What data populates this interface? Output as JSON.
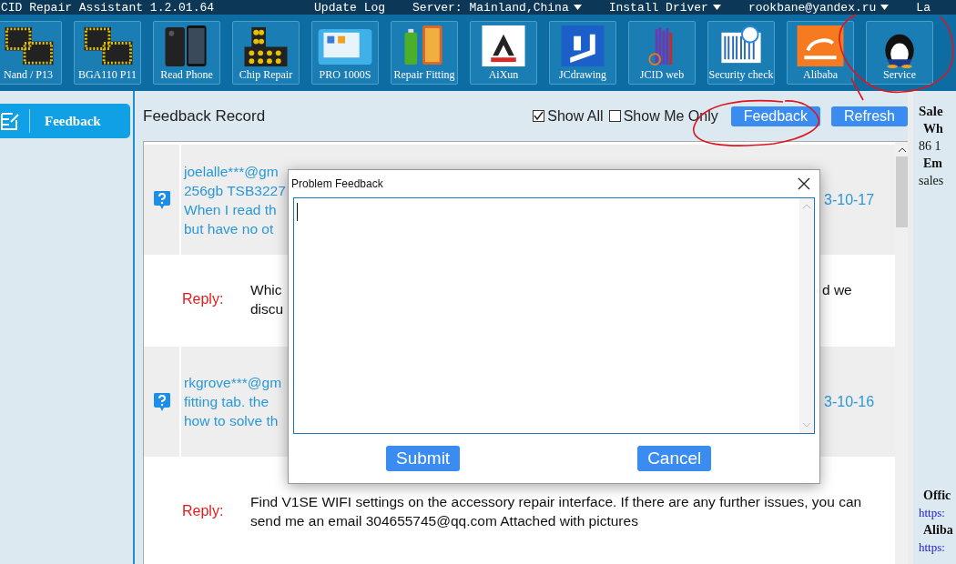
{
  "top_bar": {
    "app_title": "CID Repair Assistant 1.2.01.64",
    "menus": [
      {
        "label": "Update Log",
        "dropdown": false
      },
      {
        "label": "Server: Mainland,China",
        "dropdown": true
      },
      {
        "label": "Install Driver",
        "dropdown": true
      },
      {
        "label": "rookbane@yandex.ru",
        "dropdown": true
      },
      {
        "label": "La",
        "dropdown": false
      }
    ]
  },
  "toolbar": {
    "tools": [
      "Nand / P13",
      "BGA110 P11",
      "Read Phone",
      "Chip Repair",
      "PRO 1000S",
      "Repair Fitting",
      "AiXun",
      "JCdrawing",
      "JCID web",
      "Security check",
      "Alibaba",
      "Service"
    ]
  },
  "sidebar": {
    "items": [
      {
        "label": "Feedback",
        "selected": true
      }
    ]
  },
  "content": {
    "title": "Feedback Record",
    "filters": [
      {
        "label": "Show All",
        "checked": true
      },
      {
        "label": "Show Me Only",
        "checked": false
      }
    ],
    "buttons": [
      "Feedback",
      "Refresh"
    ],
    "records": [
      {
        "kind": "question",
        "lines": [
          "joelalle***@gm",
          "256gb TSB3227",
          "When I read th",
          "but have no ot"
        ],
        "date": "3-10-17"
      },
      {
        "kind": "reply",
        "label": "Reply:",
        "lines": [
          {
            "start": "Whic",
            "end": "d we"
          },
          {
            "start": "discu"
          }
        ]
      },
      {
        "kind": "question",
        "lines": [
          "rkgrove***@gm",
          "fitting tab. the",
          "how to solve th"
        ],
        "date": "3-10-16"
      },
      {
        "kind": "reply",
        "label": "Reply:",
        "lines": [
          {
            "start": "Find V1SE WIFI settings on the accessory repair interface. If there are any further issues, you can send me an email 304655745@qq.com Attached with pictures"
          }
        ]
      }
    ]
  },
  "right_panel": {
    "contact": [
      {
        "kind": "heading",
        "text": "Sale"
      },
      {
        "kind": "label",
        "text": "Wh"
      },
      {
        "kind": "text",
        "text": "86 1"
      },
      {
        "kind": "label",
        "text": "Em"
      },
      {
        "kind": "text",
        "text": "sales"
      }
    ],
    "links": [
      {
        "kind": "label",
        "text": "Offic"
      },
      {
        "kind": "link",
        "text": "https:"
      },
      {
        "kind": "label",
        "text": "Aliba"
      },
      {
        "kind": "link",
        "text": "https:"
      }
    ]
  },
  "dialog": {
    "title": "Problem Feedback",
    "buttons": [
      "Submit",
      "Cancel"
    ]
  }
}
